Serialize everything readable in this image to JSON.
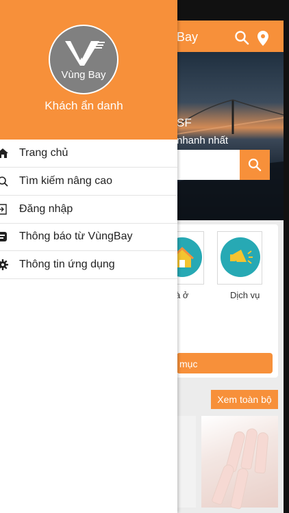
{
  "background_app": {
    "header_title": "Bay",
    "hero_title": "SF",
    "hero_subtitle": "nhanh nhất",
    "tile1_label": "à ở",
    "tile2_label": "Dịch vụ",
    "category_button_label": "mục",
    "see_all_label": "Xem toàn bộ"
  },
  "drawer": {
    "logo_text": "Vùng Bay",
    "user_name": "Khách ẩn danh",
    "menu": [
      {
        "label": "Trang chủ",
        "icon": "home-icon"
      },
      {
        "label": "Tìm kiếm nâng cao",
        "icon": "search-icon"
      },
      {
        "label": "Đăng nhập",
        "icon": "login-icon"
      },
      {
        "label": "Thông báo từ VùngBay",
        "icon": "notification-icon"
      },
      {
        "label": "Thông tin ứng dụng",
        "icon": "gear-icon"
      }
    ]
  },
  "colors": {
    "accent": "#f7903a",
    "teal": "#27a9b4",
    "logo_gray": "#808080"
  }
}
